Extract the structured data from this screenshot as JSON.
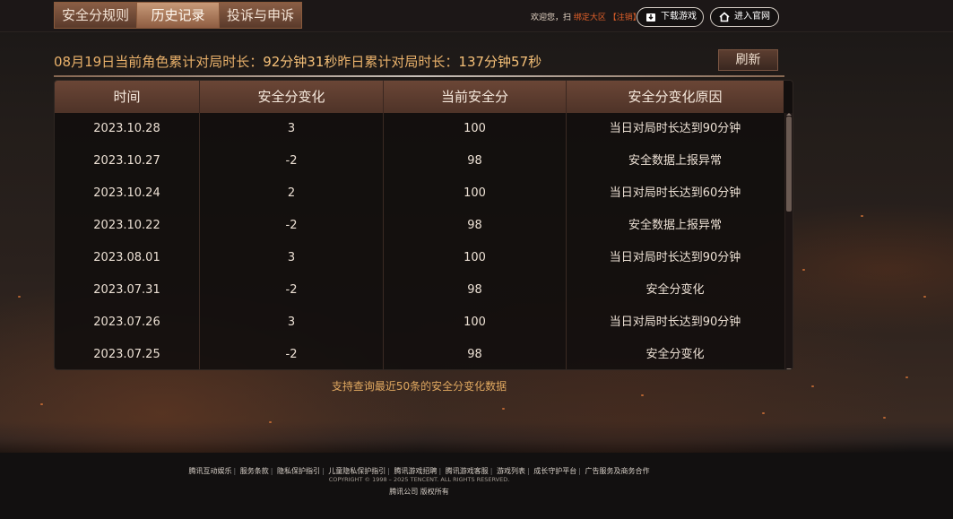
{
  "tabs": [
    "安全分规则",
    "历史记录",
    "投诉与申诉"
  ],
  "header": {
    "welcome_prefix": "欢迎您，扫",
    "region_link": "绑定大区",
    "logout_link": "【注销】",
    "download_label": "下载游戏",
    "official_label": "进入官网"
  },
  "stats": {
    "date": "08月19日",
    "current_label": "当前角色累计对局时长：",
    "current_value": "92分钟31秒",
    "yesterday_label": "昨日累计对局时长：",
    "yesterday_value": "137分钟57秒"
  },
  "refresh_label": "刷新",
  "table": {
    "headers": [
      "时间",
      "安全分变化",
      "当前安全分",
      "安全分变化原因"
    ],
    "rows": [
      [
        "2023.10.28",
        "3",
        "100",
        "当日对局时长达到90分钟"
      ],
      [
        "2023.10.27",
        "-2",
        "98",
        "安全数据上报异常"
      ],
      [
        "2023.10.24",
        "2",
        "100",
        "当日对局时长达到60分钟"
      ],
      [
        "2023.10.22",
        "-2",
        "98",
        "安全数据上报异常"
      ],
      [
        "2023.08.01",
        "3",
        "100",
        "当日对局时长达到90分钟"
      ],
      [
        "2023.07.31",
        "-2",
        "98",
        "安全分变化"
      ],
      [
        "2023.07.26",
        "3",
        "100",
        "当日对局时长达到90分钟"
      ],
      [
        "2023.07.25",
        "-2",
        "98",
        "安全分变化"
      ]
    ]
  },
  "note": "支持查询最近50条的安全分变化数据",
  "footer": {
    "links": [
      "腾讯互动娱乐",
      "服务条款",
      "隐私保护指引",
      "儿童隐私保护指引",
      "腾讯游戏招聘",
      "腾讯游戏客服",
      "游戏列表",
      "成长守护平台",
      "广告服务及商务合作"
    ],
    "copyright": "COPYRIGHT © 1998 – 2025 TENCENT. ALL RIGHTS RESERVED.",
    "owner": "腾讯公司 版权所有"
  }
}
